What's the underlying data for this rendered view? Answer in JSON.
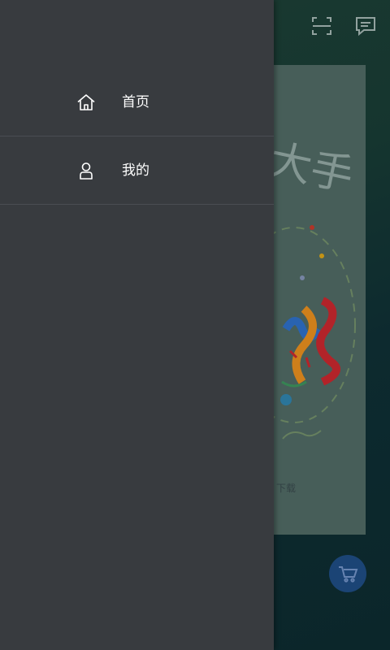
{
  "top_bar": {
    "scan_icon": "scan-icon",
    "message_icon": "message-icon"
  },
  "banner": {
    "caption": "下载"
  },
  "cart_button": {
    "icon": "shopping-cart-icon",
    "color": "#1e4a7f"
  },
  "drawer": {
    "background": "#383b3f",
    "items": [
      {
        "label": "首页",
        "icon": "home-icon"
      },
      {
        "label": "我的",
        "icon": "user-icon"
      }
    ]
  }
}
